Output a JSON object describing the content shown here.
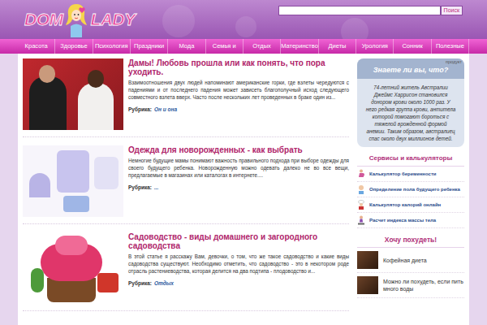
{
  "logo": {
    "first": "DOM",
    "second": "LADY"
  },
  "search": {
    "button": "Поиск"
  },
  "nav": [
    {
      "label": "Красота"
    },
    {
      "label": "Здоровье"
    },
    {
      "label": "Психология"
    },
    {
      "label": "Праздники"
    },
    {
      "label": "Мода"
    },
    {
      "label": "Семья и"
    },
    {
      "label": "Отдых"
    },
    {
      "label": "Материнство"
    },
    {
      "label": "Диеты"
    },
    {
      "label": "Урология"
    },
    {
      "label": "Сонник"
    },
    {
      "label": "Полезные"
    }
  ],
  "articles": [
    {
      "title": "Дамы! Любовь прошла или как понять, что пора уходить.",
      "excerpt": "Взаимоотношения двух людей напоминают американские горки, где взлеты чередуются с падениями и от последнего падения может зависеть благополучный исход следующего совместного взлета вверх. Часто после нескольких лет проведенных в браке один из...",
      "rubric_label": "Рубрика:",
      "rubric": "Он и она",
      "kind": "couple"
    },
    {
      "title": "Одежда для новорожденных - как выбрать",
      "excerpt": "Немногие будущие мамы понимают важность правильного подхода при выборе одежды для своего будущего ребенка. Новорожденную можно одевать далеко не во все вещи, предлагаемые в магазинах или каталогах в интернете....",
      "rubric_label": "Рубрика:",
      "rubric": "...",
      "kind": "clothes"
    },
    {
      "title": "Садоводство - виды домашнего и загородного садоводства",
      "excerpt": "В этой статье я расскажу Вам, девочки, о том, что же такое садоводство и какие виды садоводства существуют. Необходимо отметить, что садоводство - это в некотором роде отрасль растениеводства, которая делится на два подтипа - плодоводство и...",
      "rubric_label": "Рубрика:",
      "rubric": "Отдых",
      "kind": "flowers"
    }
  ],
  "sidebar": {
    "fact": {
      "tag": "продукт",
      "title": "Знаете ли вы, что?",
      "text": "74-летний житель Австралии Джеймс Харрисон становился донором крови около 1000 раз. У него редкая группа крови, антитела которой помогают бороться с тяжелой врожденной формой анемии. Таким образом, австралиец спас около двух миллионов детей."
    },
    "services": {
      "title": "Сервисы и калькуляторы",
      "items": [
        {
          "label": "Калькулятор беременности",
          "kind": "pregnancy"
        },
        {
          "label": "Определение пола будущего ребенка",
          "kind": "baby"
        },
        {
          "label": "Калькулятор калорий онлайн",
          "kind": "cook"
        },
        {
          "label": "Расчет индекса массы тела",
          "kind": "scale"
        }
      ]
    },
    "lose_weight": {
      "title": "Хочу похудеть!",
      "items": [
        {
          "label": "Кофейная диета"
        },
        {
          "label": "Можно ли похудеть, если пить много воды"
        }
      ]
    }
  }
}
